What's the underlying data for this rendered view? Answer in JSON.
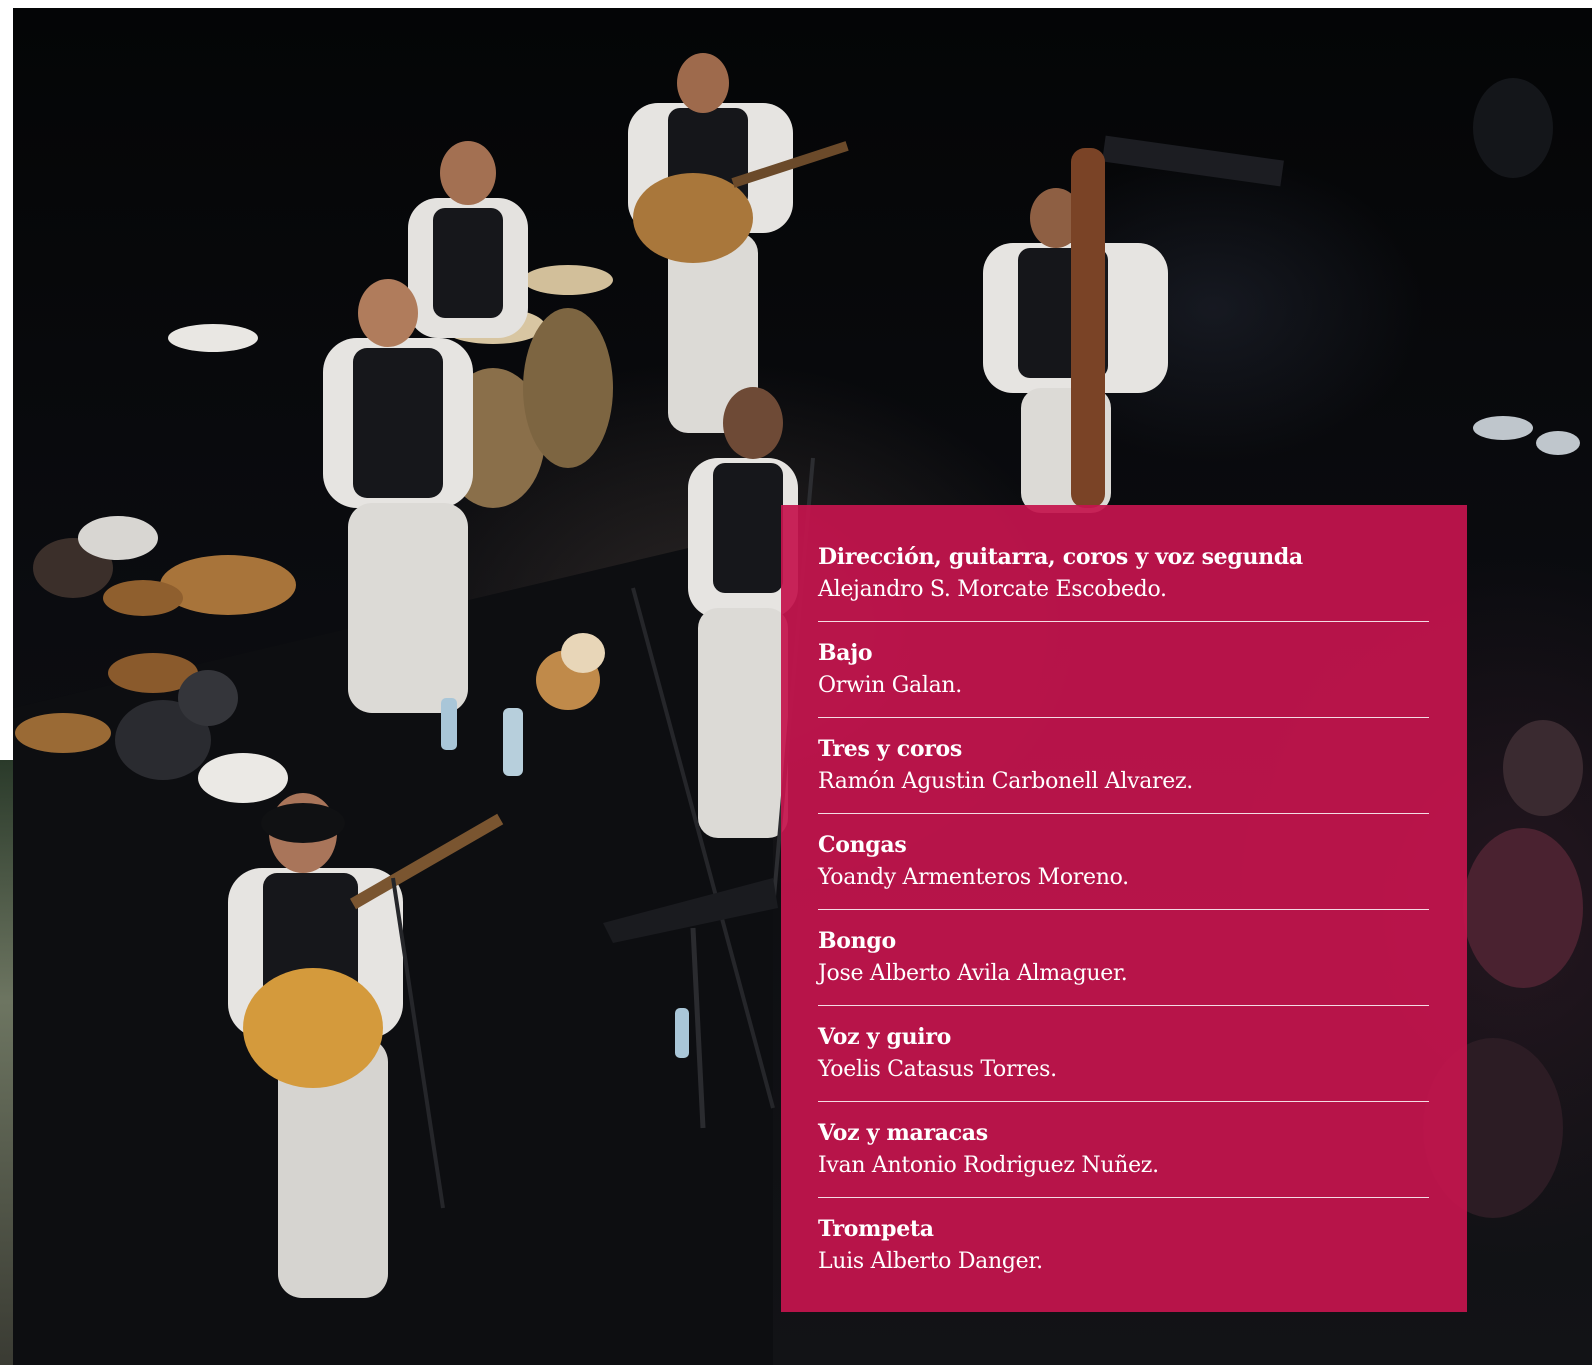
{
  "photo": {
    "subject": "concert-band-on-stage"
  },
  "credits": [
    {
      "role": "Dirección, guitarra, coros y voz segunda",
      "name": "Alejandro S. Morcate Escobedo."
    },
    {
      "role": "Bajo",
      "name": "Orwin Galan."
    },
    {
      "role": "Tres y coros",
      "name": "Ramón Agustin Carbonell Alvarez."
    },
    {
      "role": "Congas",
      "name": "Yoandy Armenteros Moreno."
    },
    {
      "role": "Bongo",
      "name": "Jose Alberto Avila Almaguer."
    },
    {
      "role": "Voz y guiro",
      "name": "Yoelis Catasus Torres."
    },
    {
      "role": "Voz y maracas",
      "name": "Ivan Antonio Rodriguez Nuñez."
    },
    {
      "role": "Trompeta",
      "name": "Luis Alberto Danger."
    }
  ],
  "colors": {
    "panel": "#c4144e",
    "text": "#ffffff"
  }
}
